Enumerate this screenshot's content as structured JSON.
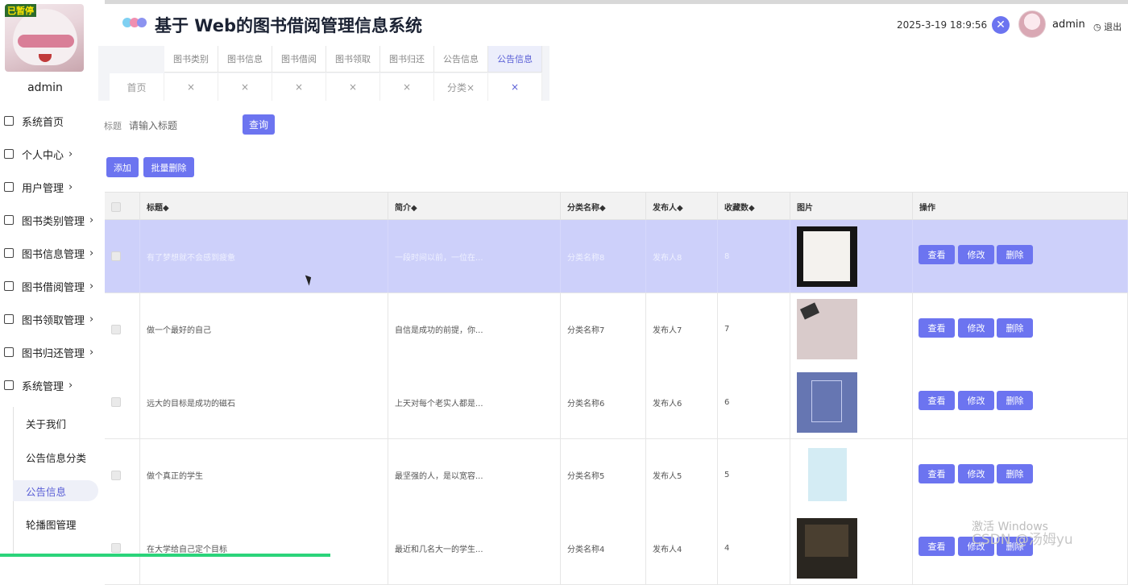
{
  "header": {
    "title": "基于 Web的图书借阅管理信息系统",
    "datetime": "2025-3-19 18:9:56",
    "username": "admin",
    "logout": "退出",
    "logo_colors": [
      "#7fd0f2",
      "#f08fb0",
      "#8c93f0"
    ]
  },
  "sidebar": {
    "avatar_tag": "已暂停",
    "username": "admin",
    "items": [
      {
        "label": "系统首页",
        "icon": "home-icon",
        "has_arrow": false
      },
      {
        "label": "个人中心",
        "icon": "user-icon",
        "has_arrow": true
      },
      {
        "label": "用户管理",
        "icon": "user-manage-icon",
        "has_arrow": true
      },
      {
        "label": "图书类别管理",
        "icon": "chart-icon",
        "has_arrow": true
      },
      {
        "label": "图书信息管理",
        "icon": "bar-chart-icon",
        "has_arrow": true
      },
      {
        "label": "图书借阅管理",
        "icon": "borrow-icon",
        "has_arrow": true
      },
      {
        "label": "图书领取管理",
        "icon": "cloud-icon",
        "has_arrow": true
      },
      {
        "label": "图书归还管理",
        "icon": "return-icon",
        "has_arrow": true
      },
      {
        "label": "系统管理",
        "icon": "download-icon",
        "has_arrow": true
      }
    ],
    "sub_items": [
      {
        "label": "关于我们",
        "active": false
      },
      {
        "label": "公告信息分类",
        "active": false
      },
      {
        "label": "公告信息",
        "active": true
      },
      {
        "label": "轮播图管理",
        "active": false
      }
    ]
  },
  "tabs": {
    "row1": [
      "图书类别",
      "图书信息",
      "图书借阅",
      "图书领取",
      "图书归还",
      "公告信息",
      "公告信息"
    ],
    "row2": [
      "首页",
      "×",
      "×",
      "×",
      "×",
      "×",
      "分类×",
      "×"
    ]
  },
  "search": {
    "label": "标题",
    "placeholder": "请输入标题",
    "button": "查询"
  },
  "actions": {
    "add": "添加",
    "batch_delete": "批量删除"
  },
  "table": {
    "columns": [
      "",
      "标题◆",
      "简介◆",
      "分类名称◆",
      "发布人◆",
      "收藏数◆",
      "图片",
      "操作"
    ],
    "rows": [
      {
        "title": "有了梦想就不会感到疲惫",
        "intro": "一段时间以前，一位在...",
        "category": "分类名称8",
        "publisher": "发布人8",
        "favorites": "8",
        "highlight": true
      },
      {
        "title": "做一个最好的自己",
        "intro": "自信是成功的前提，你...",
        "category": "分类名称7",
        "publisher": "发布人7",
        "favorites": "7",
        "highlight": false
      },
      {
        "title": "远大的目标是成功的磁石",
        "intro": "上天对每个老实人都是...",
        "category": "分类名称6",
        "publisher": "发布人6",
        "favorites": "6",
        "highlight": false
      },
      {
        "title": "做个真正的学生",
        "intro": "最坚强的人，是以宽容...",
        "category": "分类名称5",
        "publisher": "发布人5",
        "favorites": "5",
        "highlight": false
      },
      {
        "title": "在大学给自己定个目标",
        "intro": "最近和几名大一的学生...",
        "category": "分类名称4",
        "publisher": "发布人4",
        "favorites": "4",
        "highlight": false
      }
    ],
    "op_buttons": [
      "查看",
      "修改",
      "删除"
    ]
  },
  "watermark": {
    "line1": "激活 Windows",
    "line2": "CSDN @汤姆yu"
  }
}
